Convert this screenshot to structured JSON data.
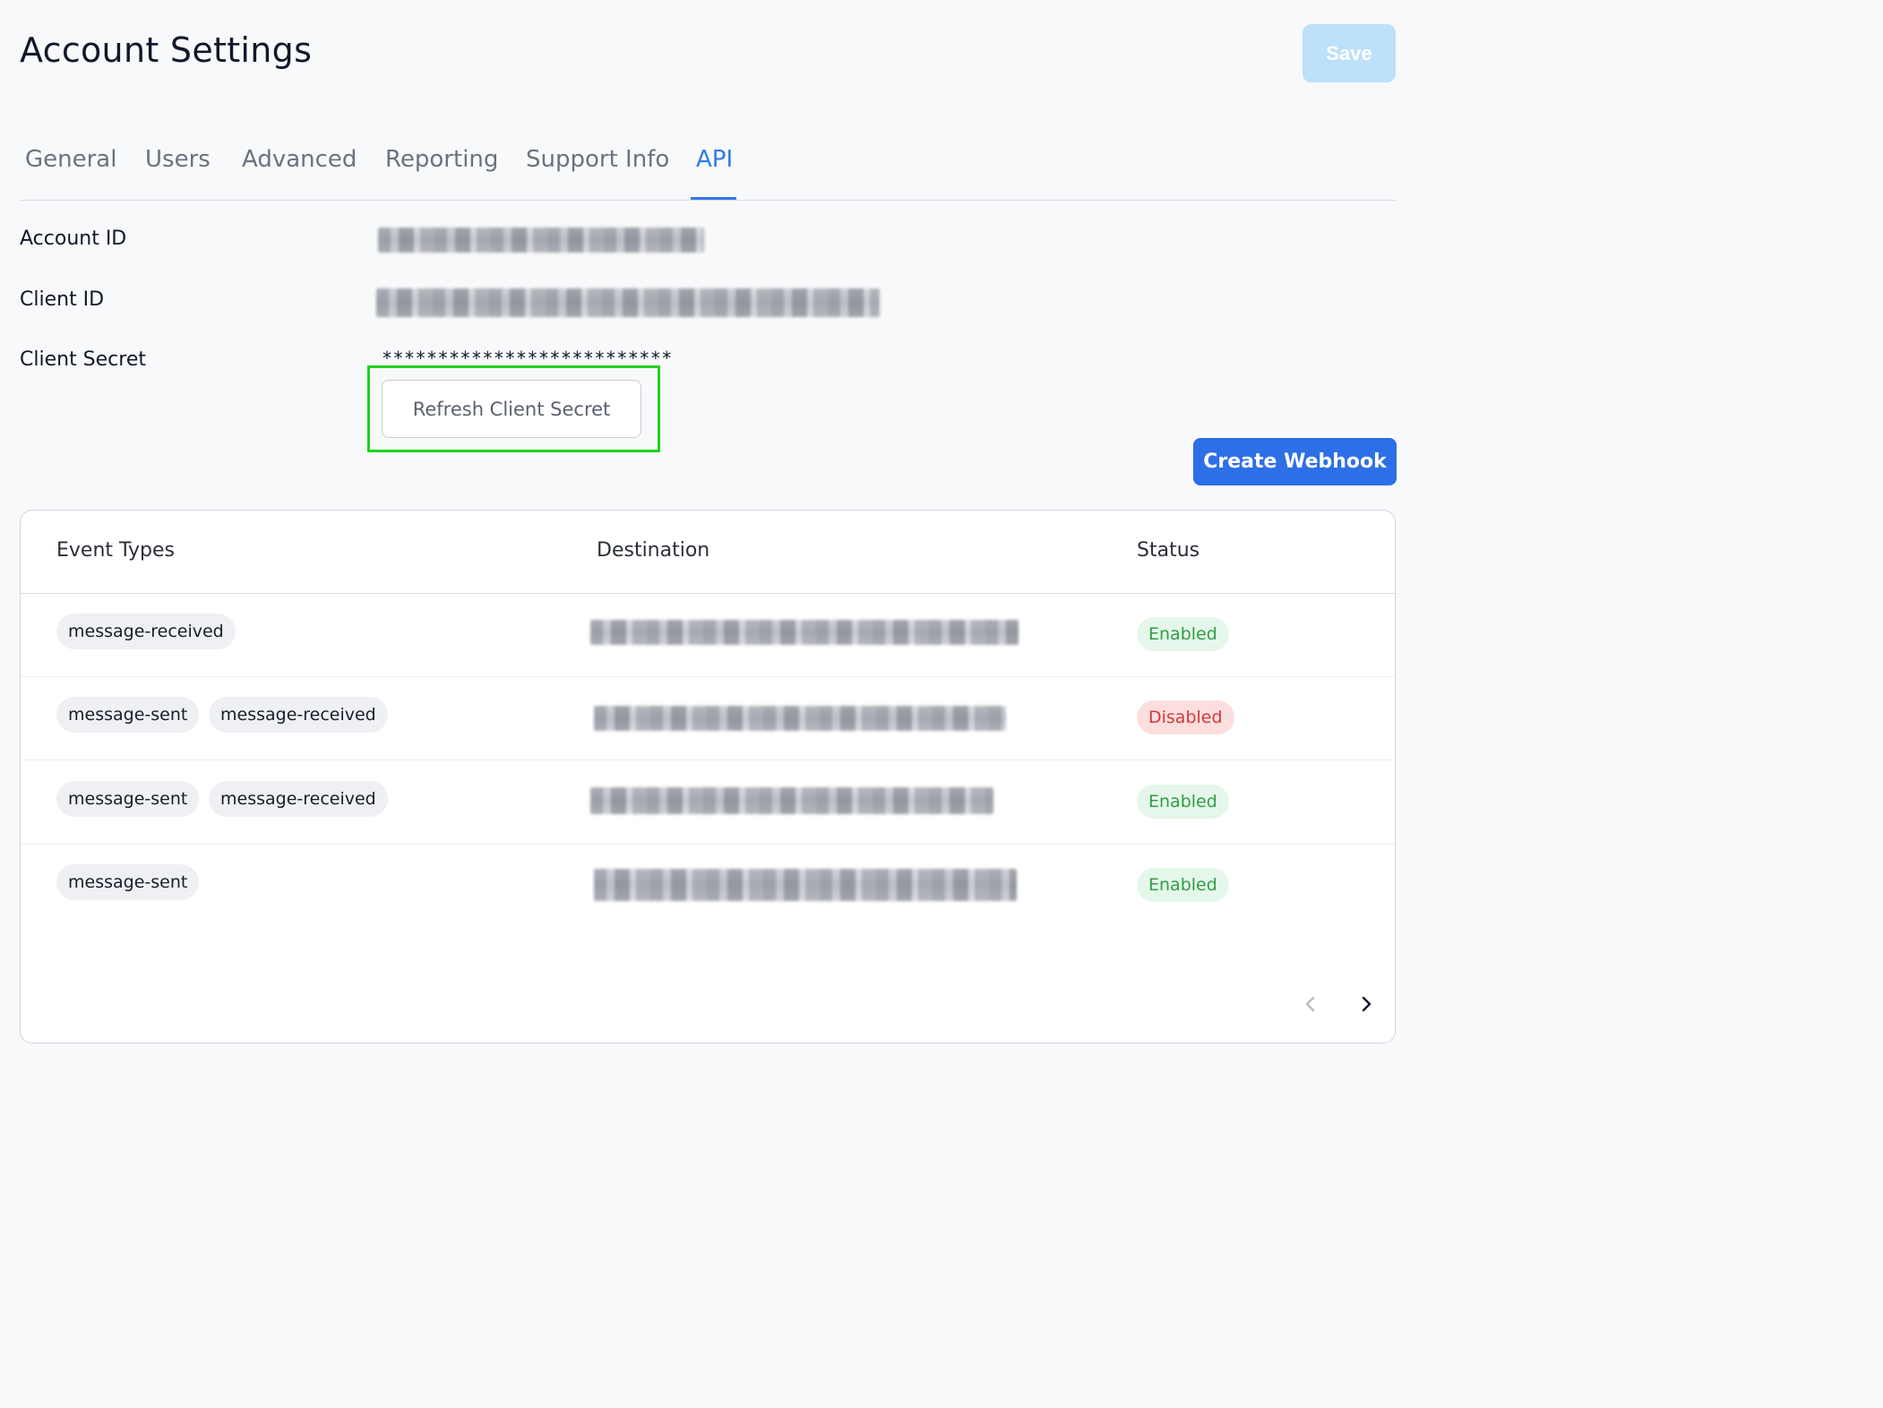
{
  "page": {
    "title": "Account Settings"
  },
  "header": {
    "save_label": "Save"
  },
  "tabs": [
    {
      "label": "General"
    },
    {
      "label": "Users"
    },
    {
      "label": "Advanced"
    },
    {
      "label": "Reporting"
    },
    {
      "label": "Support Info"
    },
    {
      "label": "API",
      "active": true
    }
  ],
  "fields": {
    "account_id_label": "Account ID",
    "client_id_label": "Client ID",
    "client_secret_label": "Client Secret",
    "client_secret_value": "**************************",
    "refresh_secret_label": "Refresh Client Secret"
  },
  "webhooks": {
    "create_label": "Create Webhook",
    "columns": [
      "Event Types",
      "Destination",
      "Status"
    ],
    "rows": [
      {
        "events": [
          "message-received"
        ],
        "status": "Enabled"
      },
      {
        "events": [
          "message-sent",
          "message-received"
        ],
        "status": "Disabled"
      },
      {
        "events": [
          "message-sent",
          "message-received"
        ],
        "status": "Enabled"
      },
      {
        "events": [
          "message-sent"
        ],
        "status": "Enabled"
      }
    ]
  },
  "pagination": {
    "prev_icon": "chevron-left-icon",
    "next_icon": "chevron-right-icon"
  },
  "colors": {
    "accent": "#2f7be6",
    "primary_button": "#2d6fe6",
    "save_disabled": "#bde0fb",
    "highlight": "#1fd11f",
    "enabled_text": "#2f9e44",
    "disabled_text": "#d23a3a"
  }
}
